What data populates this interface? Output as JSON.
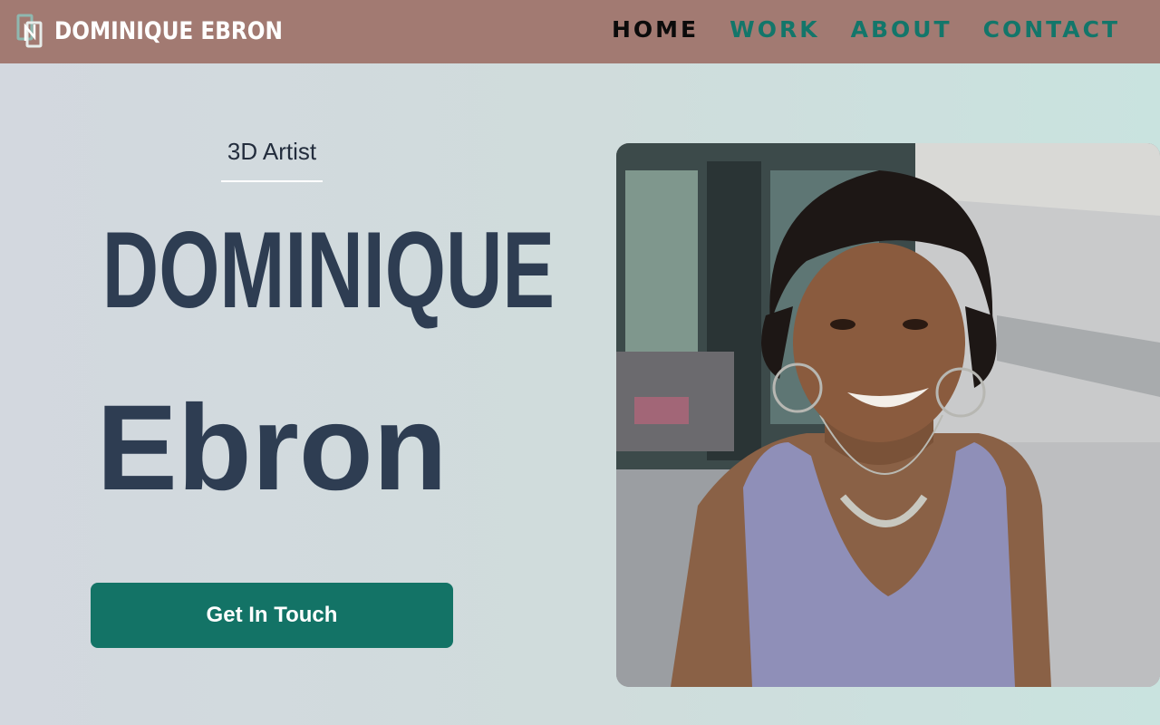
{
  "header": {
    "brand_name": "DOMINIQUE EBRON",
    "logo_icon": "monogram-logo-icon",
    "nav": [
      {
        "label": "HOME",
        "active": true
      },
      {
        "label": "WORK",
        "active": false
      },
      {
        "label": "ABOUT",
        "active": false
      },
      {
        "label": "CONTACT",
        "active": false
      }
    ]
  },
  "hero": {
    "subtitle": "3D Artist",
    "first_name": "DOMINIQUE",
    "last_name": "Ebron",
    "cta_label": "Get In Touch",
    "photo_alt": "portrait-photo"
  },
  "colors": {
    "navbar": "#a27a72",
    "accent": "#137366",
    "heading": "#2e3d52",
    "nav_active": "#0b0b0b"
  }
}
